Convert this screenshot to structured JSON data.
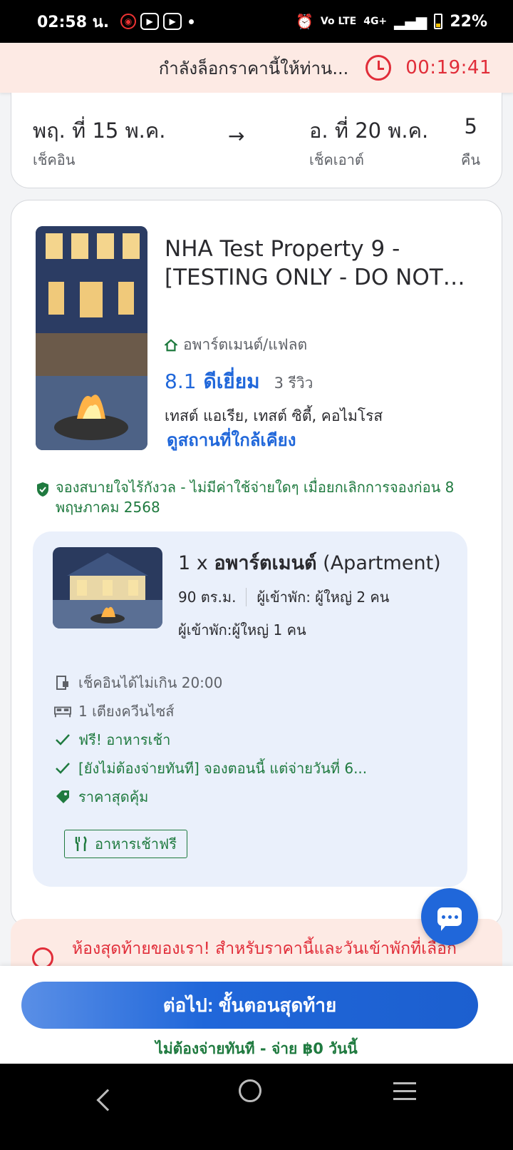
{
  "status_bar": {
    "time": "02:58 น.",
    "network": "4G+",
    "volte": "Vo LTE",
    "battery": "22%"
  },
  "price_lock": {
    "message": "กำลังล็อกราคานี้ให้ท่าน...",
    "timer": "00:19:41"
  },
  "dates": {
    "checkin_date": "พฤ. ที่ 15 พ.ค.",
    "checkin_label": "เช็คอิน",
    "checkout_date": "อ. ที่ 20 พ.ค.",
    "checkout_label": "เช็คเอาต์",
    "nights": "5",
    "nights_label": "คืน"
  },
  "property": {
    "title": "NHA Test Property 9 - [TESTING ONLY - DO NOT…",
    "type": "อพาร์ตเมนต์/แฟลต",
    "score": "8.1",
    "score_word": "ดีเยี่ยม",
    "reviews": "3 รีวิว",
    "location": "เทสต์ แอเรีย, เทสต์ ซิตี้, คอไมโรส",
    "nearby_link": "ดูสถานที่ใกล้เคียง",
    "free_cancel": "จองสบายใจไร้กังวล - ไม่มีค่าใช้จ่ายใดๆ เมื่อยกเลิกการจองก่อน 8 พฤษภาคม 2568"
  },
  "room": {
    "qty": "1 x",
    "name": "อพาร์ตเมนต์",
    "name_en": "(Apartment)",
    "size": "90 ตร.ม.",
    "guests": "ผู้เข้าพัก: ผู้ใหญ่ 2 คน",
    "guests_alt": "ผู้เข้าพัก:ผู้ใหญ่ 1 คน",
    "features": [
      {
        "icon": "checkin-door-icon",
        "text": "เช็คอินได้ไม่เกิน 20:00"
      },
      {
        "icon": "bed-icon",
        "text": "1 เตียงควีนไซส์"
      },
      {
        "icon": "check-icon",
        "text": "ฟรี! อาหารเช้า"
      },
      {
        "icon": "check-icon",
        "text": "[ยังไม่ต้องจ่ายทันที] จองตอนนี้ แต่จ่ายวันที่ 6..."
      },
      {
        "icon": "price-tag-icon",
        "text": "ราคาสุดคุ้ม"
      }
    ],
    "breakfast_tag": "อาหารเช้าฟรี"
  },
  "last_room": {
    "text": "ห้องสุดท้ายของเรา! สำหรับราคานี้และวันเข้าพักที่เลือก"
  },
  "footer": {
    "cta": "ต่อไป: ขั้นตอนสุดท้าย",
    "pay_note": "ไม่ต้องจ่ายทันที - จ่าย ฿0 วันนี้"
  },
  "colors": {
    "accent_blue": "#2067da",
    "success_green": "#1f7a3f",
    "urgency_red": "#e12d39",
    "banner_pink": "#fdeae4",
    "room_card_bg": "#eaf0fb"
  }
}
